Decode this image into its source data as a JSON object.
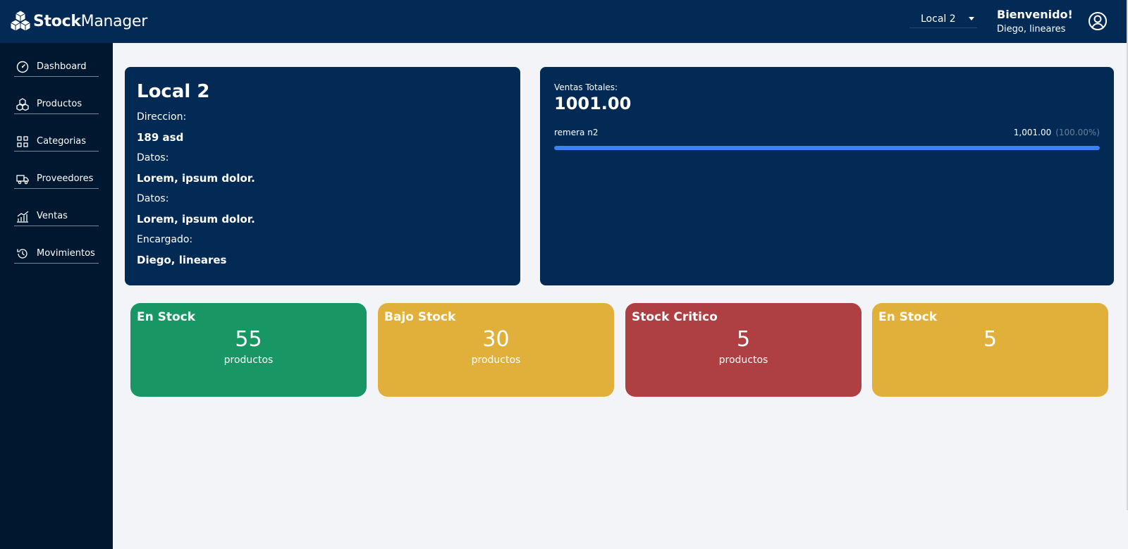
{
  "header": {
    "brand_bold": "Stock",
    "brand_light": "Manager",
    "local_select": "Local 2",
    "welcome_title": "Bienvenido!",
    "welcome_user": "Diego, lineares"
  },
  "sidebar": {
    "items": [
      {
        "label": "Dashboard",
        "icon": "gauge-icon"
      },
      {
        "label": "Productos",
        "icon": "cubes-icon"
      },
      {
        "label": "Categorias",
        "icon": "grid-icon"
      },
      {
        "label": "Proveedores",
        "icon": "truck-icon"
      },
      {
        "label": "Ventas",
        "icon": "chart-icon"
      },
      {
        "label": "Movimientos",
        "icon": "history-icon"
      }
    ]
  },
  "local": {
    "title": "Local 2",
    "fields": [
      {
        "label": "Direccion:",
        "value": "189 asd"
      },
      {
        "label": "Datos:",
        "value": "Lorem, ipsum dolor."
      },
      {
        "label": "Datos:",
        "value": "Lorem, ipsum dolor."
      },
      {
        "label": "Encargado:",
        "value": "Diego, lineares"
      }
    ]
  },
  "sales": {
    "label": "Ventas Totales:",
    "total": "1001.00",
    "items": [
      {
        "name": "remera n2",
        "amount": "1,001.00",
        "percent": "(100.00%)",
        "fraction": 1.0
      }
    ]
  },
  "stats": [
    {
      "title": "En Stock",
      "value": "55",
      "unit": "productos",
      "color": "#189663"
    },
    {
      "title": "Bajo Stock",
      "value": "30",
      "unit": "productos",
      "color": "#e0b03a"
    },
    {
      "title": "Stock Critico",
      "value": "5",
      "unit": "productos",
      "color": "#ae3f42"
    },
    {
      "title": "En Stock",
      "value": "5",
      "unit": "",
      "color": "#e0b03a"
    }
  ],
  "colors": {
    "header": "#022a55",
    "sidebar": "#001730",
    "background": "#f3f4f8",
    "progress": "#3b82f6"
  }
}
